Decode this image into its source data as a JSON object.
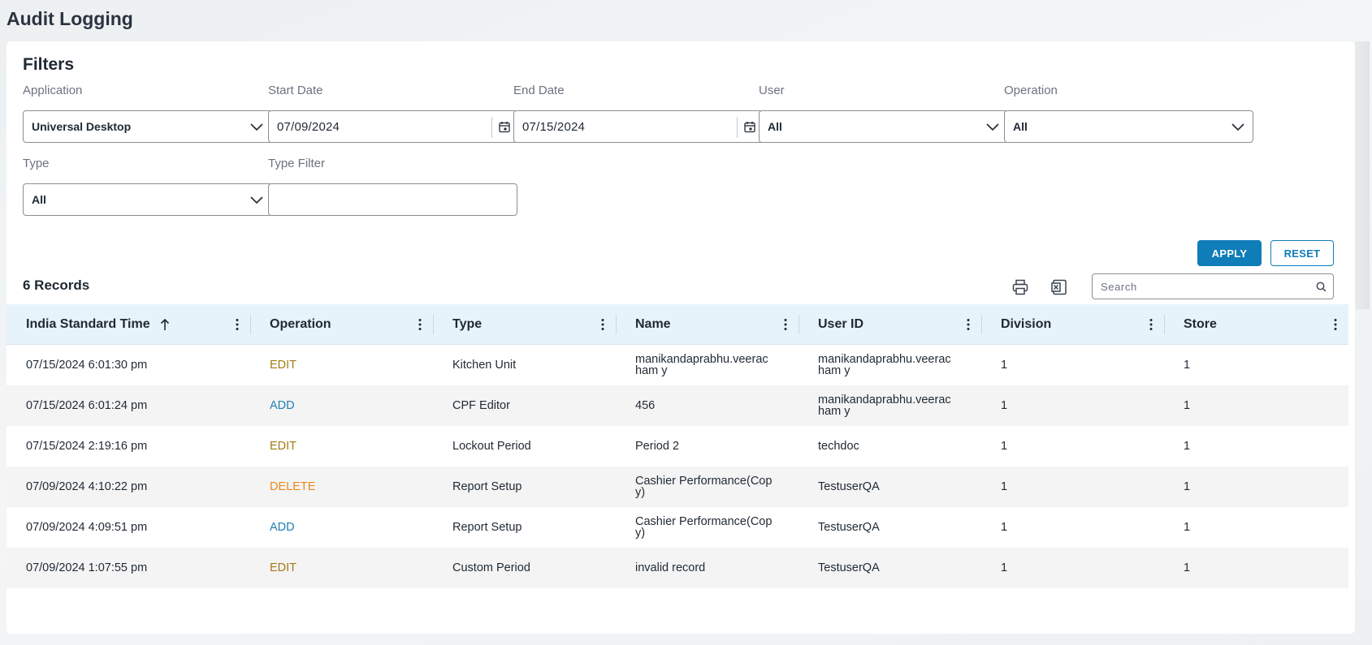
{
  "page": {
    "title": "Audit Logging"
  },
  "filters": {
    "title": "Filters",
    "application": {
      "label": "Application",
      "value": "Universal Desktop"
    },
    "start_date": {
      "label": "Start Date",
      "value": "07/09/2024"
    },
    "end_date": {
      "label": "End Date",
      "value": "07/15/2024"
    },
    "user": {
      "label": "User",
      "value": "All"
    },
    "operation": {
      "label": "Operation",
      "value": "All"
    },
    "type": {
      "label": "Type",
      "value": "All"
    },
    "type_filter": {
      "label": "Type Filter",
      "value": "",
      "placeholder": ""
    }
  },
  "actions": {
    "apply_label": "APPLY",
    "reset_label": "RESET"
  },
  "records": {
    "count_label": "6 Records"
  },
  "toolbar": {
    "print_icon": "printer-icon",
    "export_icon": "excel-export-icon"
  },
  "search": {
    "placeholder": "Search",
    "icon": "search-icon"
  },
  "table": {
    "columns": [
      "India Standard Time",
      "Operation",
      "Type",
      "Name",
      "User ID",
      "Division",
      "Store"
    ],
    "sort": {
      "column": "India Standard Time",
      "direction": "ascending"
    },
    "rows": [
      [
        "07/15/2024 6:01:30 pm",
        "EDIT",
        "Kitchen Unit",
        "manikandaprabhu.veeracham y",
        "manikandaprabhu.veeracham y",
        "1",
        "1"
      ],
      [
        "07/15/2024 6:01:24 pm",
        "ADD",
        "CPF Editor",
        "456",
        "manikandaprabhu.veeracham y",
        "1",
        "1"
      ],
      [
        "07/15/2024 2:19:16 pm",
        "EDIT",
        "Lockout Period",
        "Period 2",
        "techdoc",
        "1",
        "1"
      ],
      [
        "07/09/2024 4:10:22 pm",
        "DELETE",
        "Report Setup",
        "Cashier Performance(Copy)",
        "TestuserQA",
        "1",
        "1"
      ],
      [
        "07/09/2024 4:09:51 pm",
        "ADD",
        "Report Setup",
        "Cashier Performance(Copy)",
        "TestuserQA",
        "1",
        "1"
      ],
      [
        "07/09/2024 1:07:55 pm",
        "EDIT",
        "Custom Period",
        "invalid record",
        "TestuserQA",
        "1",
        "1"
      ]
    ]
  },
  "colors": {
    "accent": "#0f7db8",
    "header_bg": "#e6f3fa",
    "op_edit": "#a27a12",
    "op_add": "#1f7fb6",
    "op_delete": "#e8891c"
  }
}
